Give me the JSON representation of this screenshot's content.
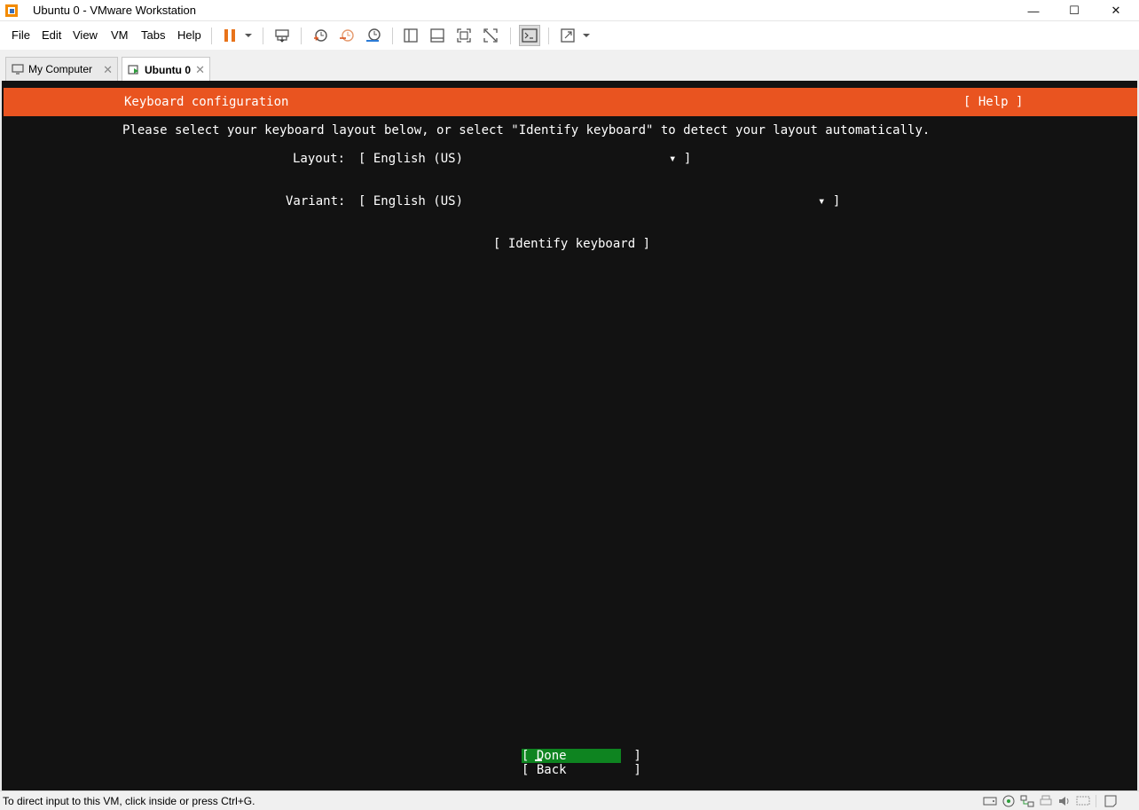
{
  "window": {
    "title": "Ubuntu 0 - VMware Workstation",
    "min_glyph": "—",
    "max_glyph": "☐",
    "close_glyph": "✕"
  },
  "menu": {
    "file": "File",
    "edit": "Edit",
    "view": "View",
    "vm": "VM",
    "tabs": "Tabs",
    "help": "Help"
  },
  "toolbar_icons": [
    "pause-icon",
    "send-ctrl-alt-del-icon",
    "snapshot-icon",
    "revert-snapshot-icon",
    "snapshot-manager-icon",
    "library-icon",
    "thumbnail-icon",
    "full-screen-icon",
    "unity-icon",
    "console-view-icon",
    "stretch-icon"
  ],
  "tabs": [
    {
      "label": "My Computer",
      "close": "✕"
    },
    {
      "label": "Ubuntu 0",
      "close": "✕"
    }
  ],
  "installer": {
    "header_title": "Keyboard configuration",
    "help": "[ Help ]",
    "instruction": "Please select your keyboard layout below, or select \"Identify keyboard\" to detect your layout automatically.",
    "layout_label": "Layout:",
    "layout_open": "[ English (US)",
    "layout_close": "▾ ]",
    "variant_label": "Variant:",
    "variant_open": "[ English (US)",
    "variant_close": "▾ ]",
    "identify": "[ Identify keyboard ]",
    "done": "[ Done         ]",
    "back": "[ Back         ]"
  },
  "statusbar": {
    "text": "To direct input to this VM, click inside or press Ctrl+G."
  },
  "colors": {
    "ubuntu_orange": "#e95420",
    "done_green": "#0e8420",
    "terminal_bg": "#121212"
  }
}
